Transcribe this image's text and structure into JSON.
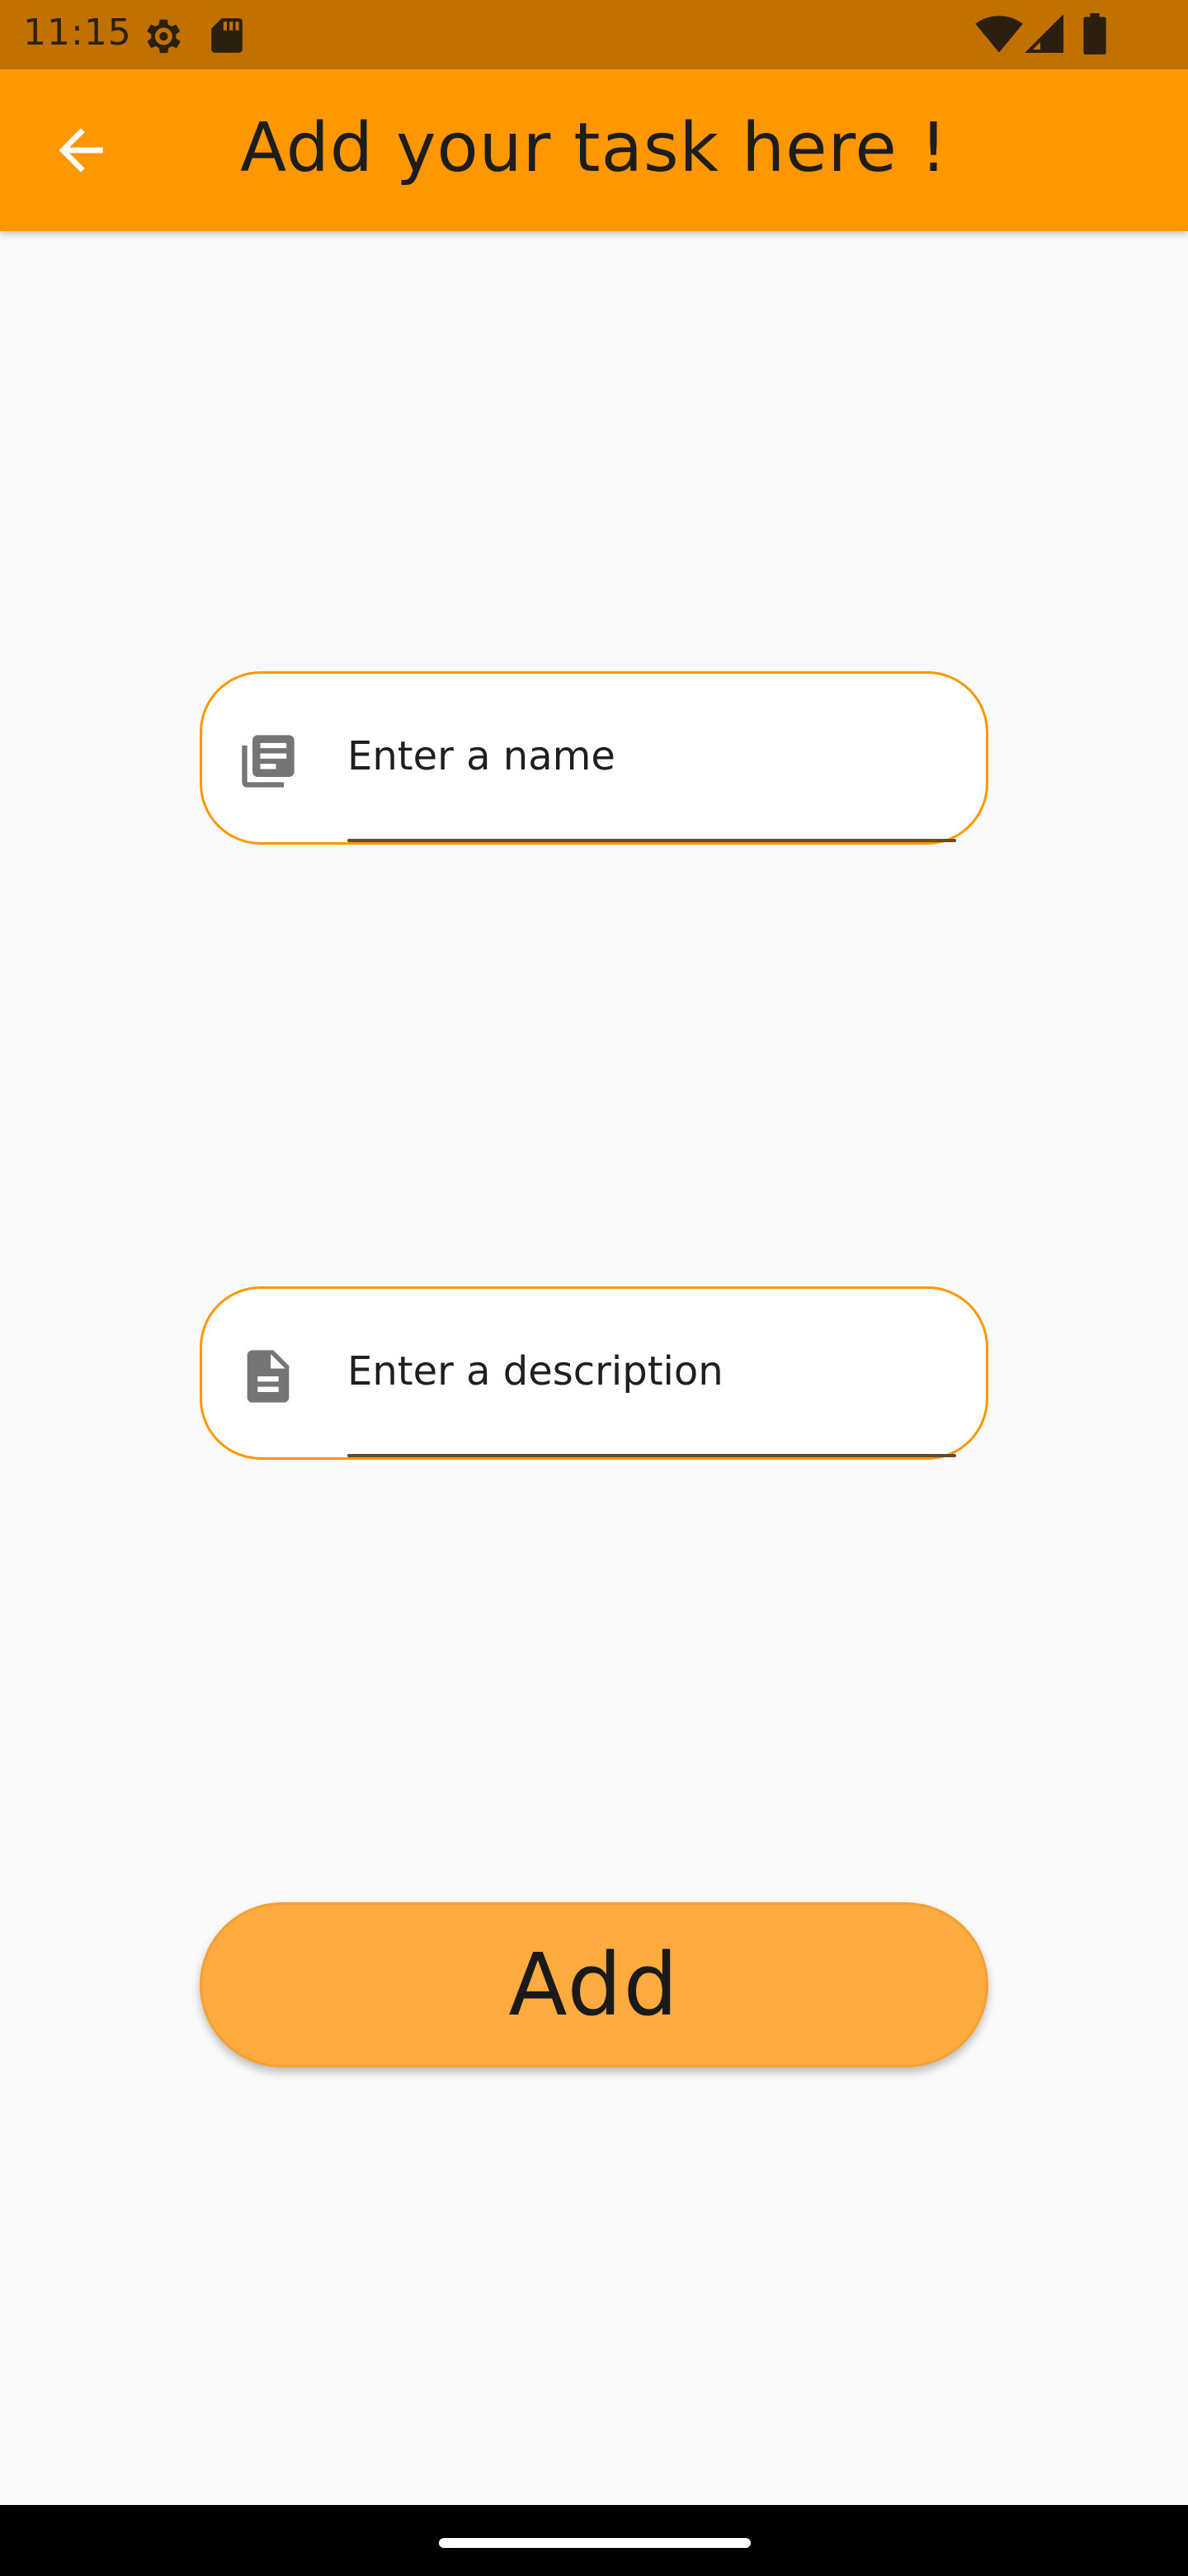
{
  "status_bar": {
    "time": "11:15",
    "icons": [
      "settings-gear-icon",
      "sd-card-icon",
      "wifi-icon",
      "cell-signal-icon",
      "battery-icon"
    ]
  },
  "app_bar": {
    "title": "Add your task here !",
    "back_icon": "arrow-back-icon",
    "color": "#ff9800"
  },
  "form": {
    "name_field": {
      "icon": "library-books-icon",
      "placeholder": "Enter a name",
      "value": ""
    },
    "description_field": {
      "icon": "description-icon",
      "placeholder": "Enter a description",
      "value": ""
    },
    "submit": {
      "label": "Add",
      "color": "#ffab40"
    }
  },
  "colors": {
    "accent": "#ff9800",
    "status_bar": "#c07100",
    "background": "#fafafa"
  }
}
